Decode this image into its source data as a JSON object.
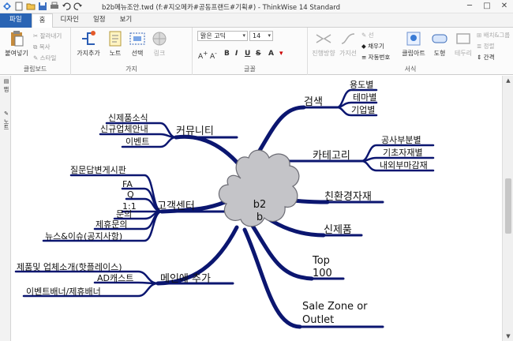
{
  "window": {
    "title": "b2b메뉴조안.twd (f:#지오메카#공동프랜드#기획#) - ThinkWise 14 Standard",
    "buttons": [
      "─",
      "□",
      "✕"
    ]
  },
  "tabs": [
    "파일",
    "홈",
    "디자인",
    "일정",
    "보기"
  ],
  "active_tab": "홈",
  "ribbon": {
    "clipboard": {
      "paste": "붙여넣기",
      "cut": "잘라내기",
      "copy": "복사",
      "style": "스타일",
      "label": "클립보드"
    },
    "branch": {
      "add_branch": "가지추가",
      "note": "노트",
      "select": "선택",
      "link": "링크",
      "label": "가지"
    },
    "font": {
      "family": "맑은 고딕",
      "size": "14",
      "label": "글꼴"
    },
    "style": {
      "direction": "진행방향",
      "shape": "가지선",
      "line": "선",
      "fill": "채우기",
      "autonumber": "자동번호",
      "clipart": "클립아트",
      "figure": "도형",
      "border": "테두리",
      "layout": "배치&그룹",
      "align": "정렬",
      "spacing": "간격",
      "label": "서식"
    }
  },
  "leftrail": [
    "맵",
    "노트"
  ],
  "mindmap": {
    "center": [
      "b2",
      "b"
    ],
    "branches": [
      {
        "label": "검색",
        "children": [
          "용도별",
          "테마별",
          "기업별"
        ]
      },
      {
        "label": "카테고리",
        "children": [
          "공사부분별",
          "기초자재별",
          "내외부마감재"
        ]
      },
      {
        "label": "친환경자재",
        "children": []
      },
      {
        "label": "신제품",
        "children": []
      },
      {
        "label": [
          "Top",
          "100"
        ],
        "children": []
      },
      {
        "label": [
          "Sale Zone or",
          "Outlet"
        ],
        "children": []
      },
      {
        "label": "커뮤니티",
        "children": [
          "신제품소식",
          "신규업체안내",
          "이벤트"
        ]
      },
      {
        "label": "고객센터",
        "children": [
          "질문답변게시판",
          "FA",
          "Q",
          "1:1",
          "문의",
          "제휴문의",
          "뉴스&이슈(공지사항)"
        ]
      },
      {
        "label": "메인에 추가",
        "children": [
          "제품및  업체소개(핫플레이스)",
          "AD캐스트",
          "이벤트배너/제휴배너"
        ]
      }
    ]
  },
  "colors": {
    "branch": "#0b1670",
    "cloud_fill": "#c4c4c8",
    "cloud_stroke": "#6c6c74",
    "file_tab": "#2a64b4"
  }
}
